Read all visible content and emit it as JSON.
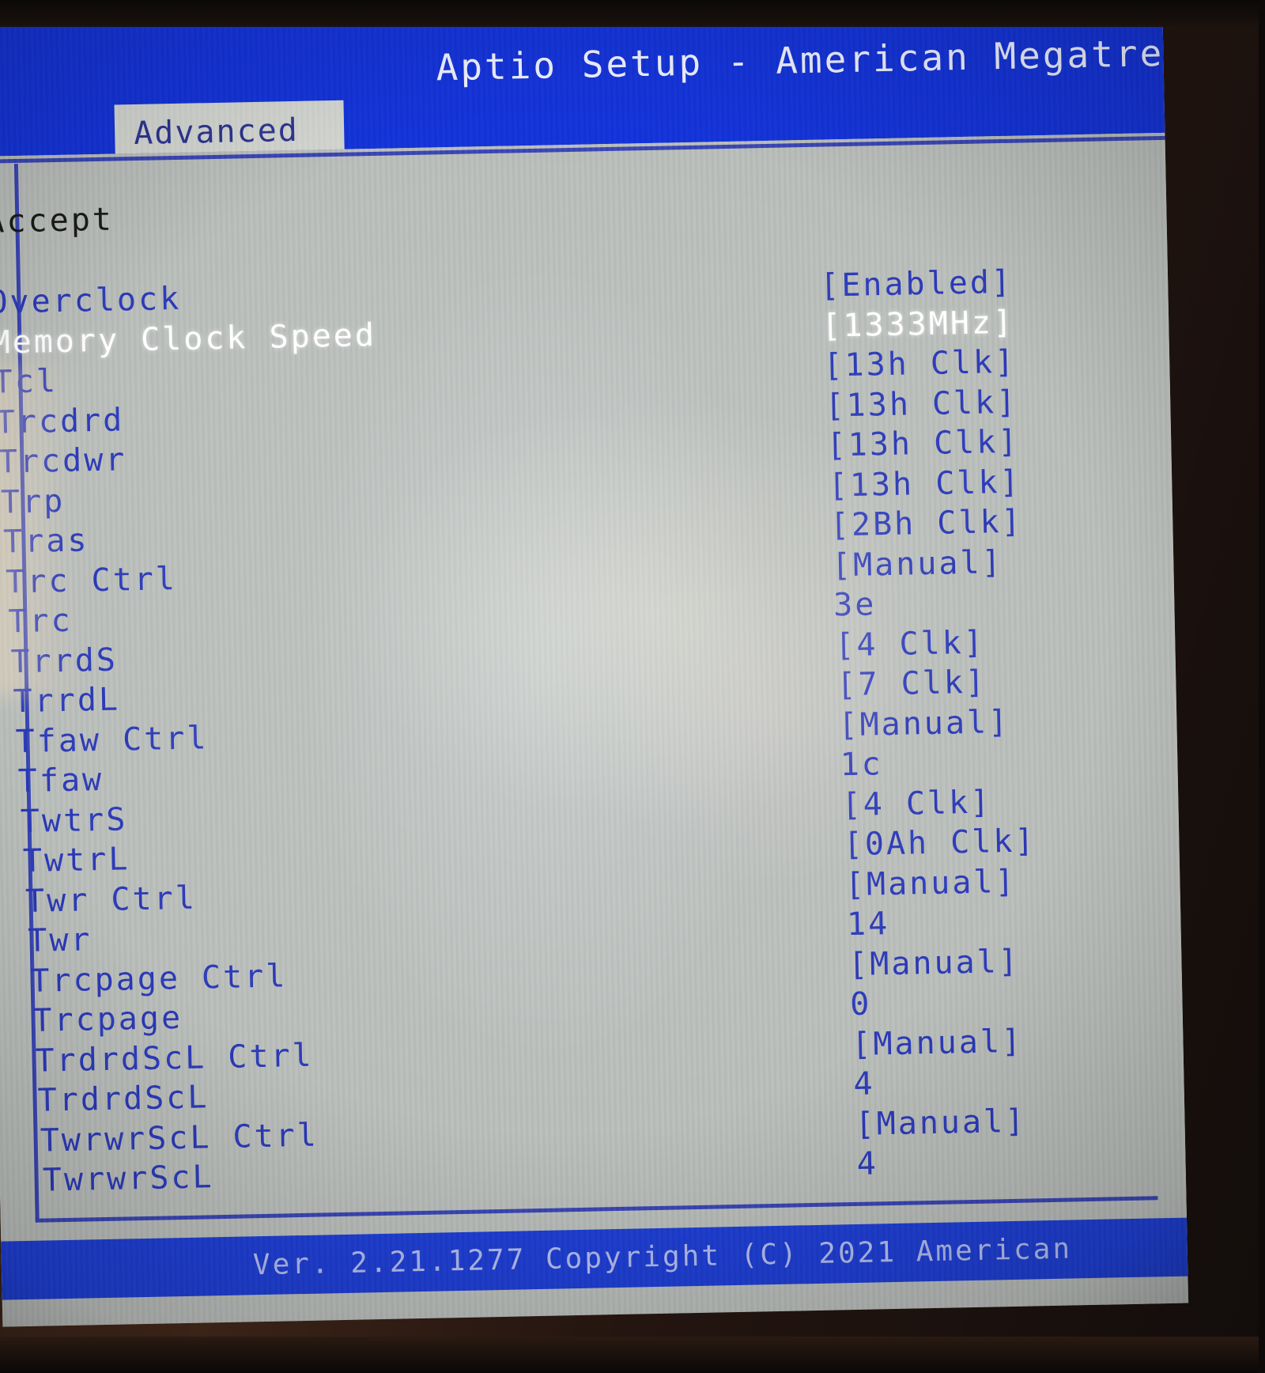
{
  "window": {
    "title": "Aptio Setup - American Megatre",
    "tab_label": "Advanced"
  },
  "footer": {
    "version_text": "Ver. 2.21.1277 Copyright (C) 2021 American"
  },
  "colors": {
    "title_bar": "#1534d8",
    "screen_bg": "#b9bdba",
    "text_blue": "#2b3ab8",
    "text_selected": "#ffffff",
    "heading_text": "#1a1a1a",
    "tab_bg": "#d2d5d0",
    "border_blue": "#3a46b4"
  },
  "menu": {
    "heading": "Accept",
    "rows": [
      {
        "label": "Overclock",
        "value": "[Enabled]",
        "selected": false
      },
      {
        "label": "Memory Clock Speed",
        "value": "[1333MHz]",
        "selected": true
      },
      {
        "label": "Tcl",
        "value": "[13h Clk]",
        "selected": false
      },
      {
        "label": "Trcdrd",
        "value": "[13h Clk]",
        "selected": false
      },
      {
        "label": "Trcdwr",
        "value": "[13h Clk]",
        "selected": false
      },
      {
        "label": "Trp",
        "value": "[13h Clk]",
        "selected": false
      },
      {
        "label": "Tras",
        "value": "[2Bh Clk]",
        "selected": false
      },
      {
        "label": "Trc Ctrl",
        "value": "[Manual]",
        "selected": false
      },
      {
        "label": "Trc",
        "value": "3e",
        "selected": false
      },
      {
        "label": "TrrdS",
        "value": "[4 Clk]",
        "selected": false
      },
      {
        "label": "TrrdL",
        "value": "[7 Clk]",
        "selected": false
      },
      {
        "label": "Tfaw Ctrl",
        "value": "[Manual]",
        "selected": false
      },
      {
        "label": "Tfaw",
        "value": "1c",
        "selected": false
      },
      {
        "label": "TwtrS",
        "value": "[4 Clk]",
        "selected": false
      },
      {
        "label": "TwtrL",
        "value": "[0Ah Clk]",
        "selected": false
      },
      {
        "label": "Twr Ctrl",
        "value": "[Manual]",
        "selected": false
      },
      {
        "label": "Twr",
        "value": "14",
        "selected": false
      },
      {
        "label": "Trcpage Ctrl",
        "value": "[Manual]",
        "selected": false
      },
      {
        "label": "Trcpage",
        "value": "0",
        "selected": false
      },
      {
        "label": "TrdrdScL Ctrl",
        "value": "[Manual]",
        "selected": false
      },
      {
        "label": "TrdrdScL",
        "value": "4",
        "selected": false
      },
      {
        "label": "TwrwrScL Ctrl",
        "value": "[Manual]",
        "selected": false
      },
      {
        "label": "TwrwrScL",
        "value": "4",
        "selected": false
      }
    ]
  }
}
